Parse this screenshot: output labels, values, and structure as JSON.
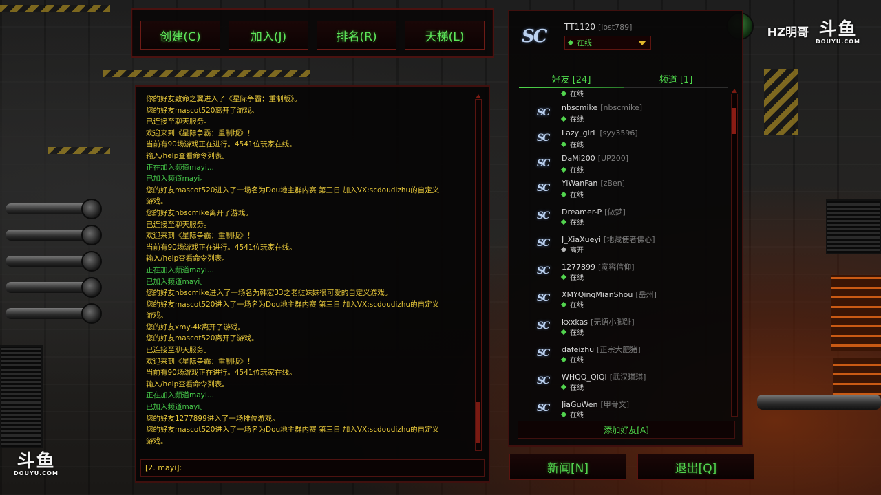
{
  "top_buttons": [
    "创建(C)",
    "加入(J)",
    "排名(R)",
    "天梯(L)"
  ],
  "chat": {
    "lines": [
      {
        "text": "你的好友致命之翼进入了《星际争霸：重制版》。",
        "color": "yellow"
      },
      {
        "text": "您的好友mascot520离开了游戏。",
        "color": "yellow"
      },
      {
        "text": "已连接至聊天服务。",
        "color": "yellow"
      },
      {
        "text": "欢迎来到《星际争霸：重制版》！",
        "color": "yellow"
      },
      {
        "text": "当前有90场游戏正在进行。4541位玩家在线。",
        "color": "yellow"
      },
      {
        "text": "输入/help查看命令列表。",
        "color": "yellow"
      },
      {
        "text": "正在加入频道mayi...",
        "color": "green"
      },
      {
        "text": "已加入频道mayi。",
        "color": "green"
      },
      {
        "text": "您的好友mascot520进入了一场名为Dou地主群内赛 第三日 加入VX:scdoudizhu的自定义",
        "color": "yellow"
      },
      {
        "text": "游戏。",
        "color": "yellow"
      },
      {
        "text": "您的好友nbscmike离开了游戏。",
        "color": "yellow"
      },
      {
        "text": "已连接至聊天服务。",
        "color": "yellow"
      },
      {
        "text": "欢迎来到《星际争霸：重制版》！",
        "color": "yellow"
      },
      {
        "text": "当前有90场游戏正在进行。4541位玩家在线。",
        "color": "yellow"
      },
      {
        "text": "输入/help查看命令列表。",
        "color": "yellow"
      },
      {
        "text": "正在加入频道mayi...",
        "color": "green"
      },
      {
        "text": "已加入频道mayi。",
        "color": "green"
      },
      {
        "text": "您的好友nbscmike进入了一场名为韩宏33之老挝妹妹很可爱的自定义游戏。",
        "color": "yellow"
      },
      {
        "text": "您的好友mascot520进入了一场名为Dou地主群内赛 第三日 加入VX:scdoudizhu的自定义",
        "color": "yellow"
      },
      {
        "text": "游戏。",
        "color": "yellow"
      },
      {
        "text": "您的好友xmy-4k离开了游戏。",
        "color": "yellow"
      },
      {
        "text": "您的好友mascot520离开了游戏。",
        "color": "yellow"
      },
      {
        "text": "已连接至聊天服务。",
        "color": "yellow"
      },
      {
        "text": "欢迎来到《星际争霸：重制版》！",
        "color": "yellow"
      },
      {
        "text": "当前有90场游戏正在进行。4541位玩家在线。",
        "color": "yellow"
      },
      {
        "text": "输入/help查看命令列表。",
        "color": "yellow"
      },
      {
        "text": "正在加入频道mayi...",
        "color": "green"
      },
      {
        "text": "已加入频道mayi。",
        "color": "green"
      },
      {
        "text": "您的好友1277899进入了一场排位游戏。",
        "color": "yellow"
      },
      {
        "text": "您的好友mascot520进入了一场名为Dou地主群内赛 第三日 加入VX:scdoudizhu的自定义",
        "color": "yellow"
      },
      {
        "text": "游戏。",
        "color": "yellow"
      }
    ],
    "input_prefix": "[2. mayi]:"
  },
  "profile": {
    "logo": "SC",
    "name": "TT1120",
    "tag": "[lost789]",
    "status": "在线"
  },
  "tabs": {
    "friends": "好友 [24]",
    "channel": "频道 [1]"
  },
  "friends": {
    "partial_top_status": "在线",
    "items": [
      {
        "name": "nbscmike",
        "alias": "[nbscmike]",
        "status": "在线"
      },
      {
        "name": "Lazy_girL",
        "alias": "[syy3596]",
        "status": "在线"
      },
      {
        "name": "DaMi200",
        "alias": "[UP200]",
        "status": "在线"
      },
      {
        "name": "YiWanFan",
        "alias": "[zBen]",
        "status": "在线"
      },
      {
        "name": "Dreamer-P",
        "alias": "[做梦]",
        "status": "在线"
      },
      {
        "name": "J_XiaXueyi",
        "alias": "[地藏使者佛心]",
        "status": "离开"
      },
      {
        "name": "1277899",
        "alias": "[宽容信仰]",
        "status": "在线"
      },
      {
        "name": "XMYQingMianShou",
        "alias": "[岳州]",
        "status": "在线"
      },
      {
        "name": "kxxkas",
        "alias": "[无语小脚趾]",
        "status": "在线"
      },
      {
        "name": "dafeizhu",
        "alias": "[正宗大肥猪]",
        "status": "在线"
      },
      {
        "name": "WHQQ_QIQI",
        "alias": "[武汉琪琪]",
        "status": "在线"
      },
      {
        "name": "JiaGuWen",
        "alias": "[甲骨文]",
        "status": "在线"
      }
    ],
    "add_friend": "添加好友[A]"
  },
  "bottom_buttons": {
    "news": "新闻[N]",
    "quit": "退出[Q]"
  },
  "overlay": {
    "streamer": "HZ明哥",
    "platform_big": "斗鱼",
    "platform_small": "DOUYU.COM"
  },
  "colors": {
    "chat_yellow": "#e6c73a",
    "chat_green": "#46c94a",
    "button_text": "#52d44e",
    "frame_red": "#6d1b16"
  }
}
